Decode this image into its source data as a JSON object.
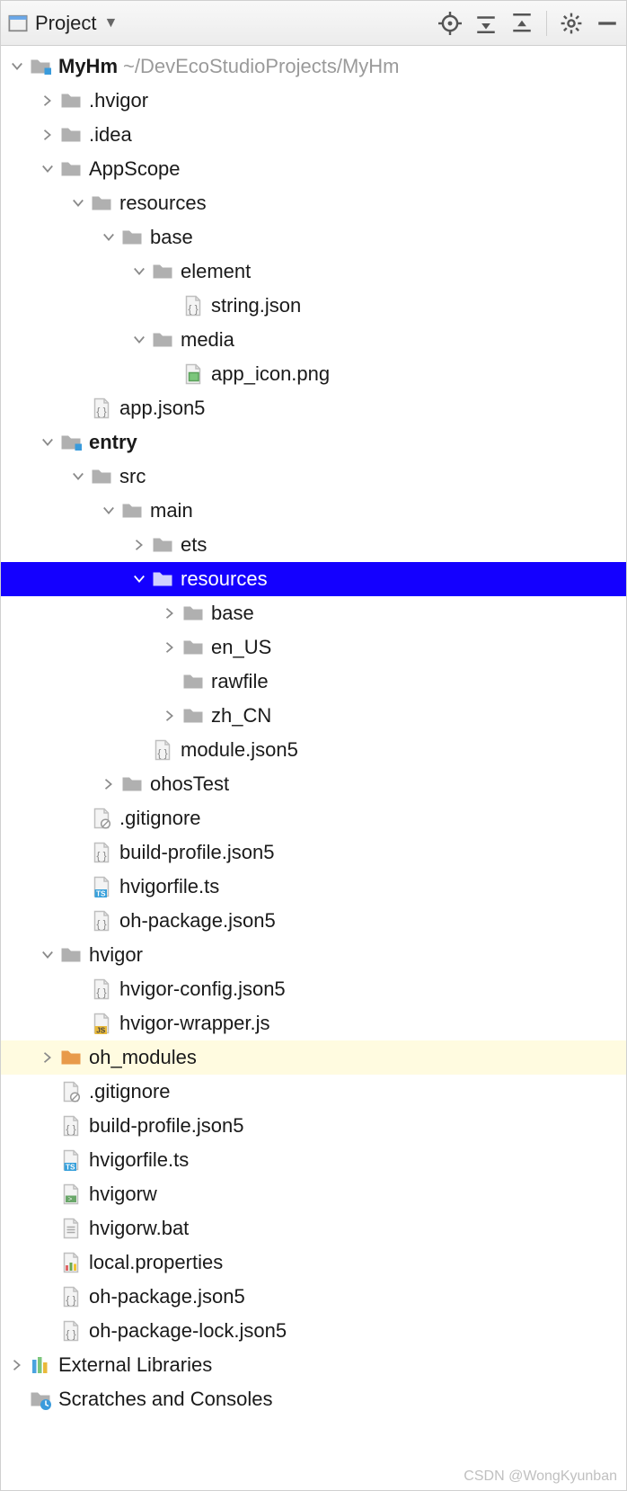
{
  "toolbar": {
    "view_label": "Project"
  },
  "tree": {
    "root_name": "MyHm",
    "root_hint": "~/DevEcoStudioProjects/MyHm",
    "hvigor_dir": ".hvigor",
    "idea_dir": ".idea",
    "appscope": "AppScope",
    "resources1": "resources",
    "base1": "base",
    "element": "element",
    "string_json": "string.json",
    "media": "media",
    "app_icon": "app_icon.png",
    "app_json5": "app.json5",
    "entry": "entry",
    "src": "src",
    "main": "main",
    "ets": "ets",
    "resources2": "resources",
    "base2": "base",
    "en_us": "en_US",
    "rawfile": "rawfile",
    "zh_cn": "zh_CN",
    "module_json5": "module.json5",
    "ohostest": "ohosTest",
    "gitignore1": ".gitignore",
    "build_profile1": "build-profile.json5",
    "hvigorfile_ts1": "hvigorfile.ts",
    "oh_package1": "oh-package.json5",
    "hvigor_folder": "hvigor",
    "hvigor_config": "hvigor-config.json5",
    "hvigor_wrapper": "hvigor-wrapper.js",
    "oh_modules": "oh_modules",
    "gitignore2": ".gitignore",
    "build_profile2": "build-profile.json5",
    "hvigorfile_ts2": "hvigorfile.ts",
    "hvigorw": "hvigorw",
    "hvigorw_bat": "hvigorw.bat",
    "local_properties": "local.properties",
    "oh_package2": "oh-package.json5",
    "oh_package_lock": "oh-package-lock.json5",
    "ext_libs": "External Libraries",
    "scratches": "Scratches and Consoles"
  },
  "watermark": "CSDN @WongKyunban"
}
